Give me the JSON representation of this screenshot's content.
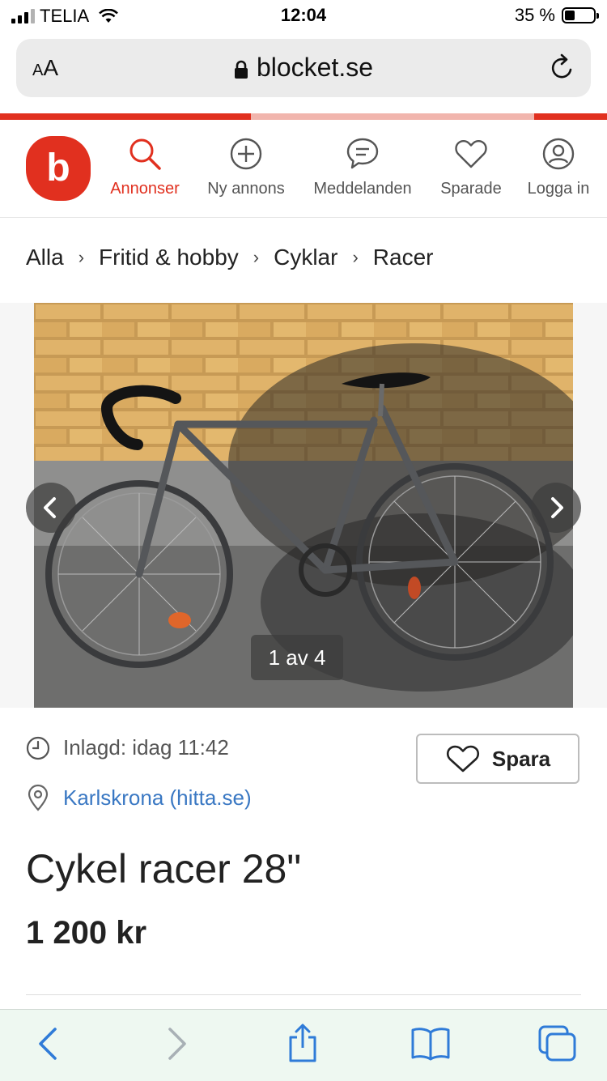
{
  "status_bar": {
    "carrier": "TELIA",
    "time": "12:04",
    "battery": "35 %"
  },
  "browser": {
    "text_size_label_small": "A",
    "text_size_label_large": "A",
    "domain": "blocket.se"
  },
  "header": {
    "logo_letter": "b",
    "nav": [
      {
        "label": "Annonser"
      },
      {
        "label": "Ny annons"
      },
      {
        "label": "Meddelanden"
      },
      {
        "label": "Sparade"
      },
      {
        "label": "Logga in"
      }
    ]
  },
  "breadcrumb": [
    "Alla",
    "Fritid & hobby",
    "Cyklar",
    "Racer"
  ],
  "gallery": {
    "counter": "1 av 4"
  },
  "listing": {
    "posted": "Inlagd: idag 11:42",
    "location": "Karlskrona (hitta.se)",
    "save_label": "Spara",
    "title": "Cykel racer 28\"",
    "price": "1 200 kr"
  },
  "colors": {
    "brand": "#e1301f",
    "link": "#3a78c3",
    "ios_blue": "#2f7bd8"
  }
}
